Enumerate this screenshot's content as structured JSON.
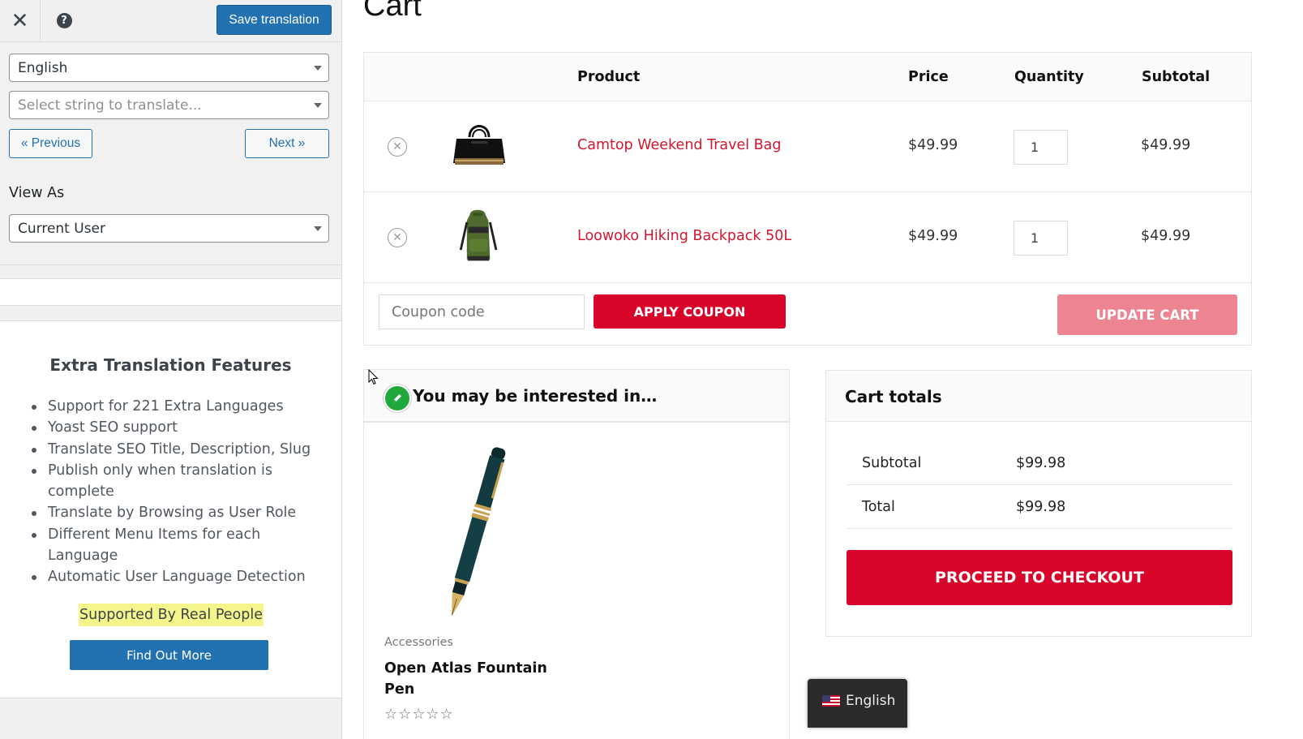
{
  "panel": {
    "close_glyph": "✕",
    "help_glyph": "?",
    "save_label": "Save translation",
    "language_value": "English",
    "string_placeholder": "Select string to translate...",
    "previous_label": "« Previous",
    "next_label": "Next »",
    "view_as_label": "View As",
    "view_as_value": "Current User",
    "promo": {
      "title": "Extra Translation Features",
      "features": [
        "Support for 221 Extra Languages",
        "Yoast SEO support",
        "Translate SEO Title, Description, Slug",
        "Publish only when translation is complete",
        "Translate by Browsing as User Role",
        "Different Menu Items for each Language",
        "Automatic User Language Detection"
      ],
      "highlight": "Supported By Real People",
      "button_label": "Find Out More"
    }
  },
  "page": {
    "title": "Cart"
  },
  "cart": {
    "headers": {
      "product": "Product",
      "price": "Price",
      "quantity": "Quantity",
      "subtotal": "Subtotal"
    },
    "remove_glyph": "✕",
    "items": [
      {
        "name": "Camtop Weekend Travel Bag",
        "price": "$49.99",
        "quantity": "1",
        "subtotal": "$49.99",
        "image_icon": "travel-bag-image"
      },
      {
        "name": "Loowoko Hiking Backpack 50L",
        "price": "$49.99",
        "quantity": "1",
        "subtotal": "$49.99",
        "image_icon": "backpack-image"
      }
    ],
    "coupon_placeholder": "Coupon code",
    "apply_label": "APPLY COUPON",
    "update_label": "UPDATE CART"
  },
  "interested": {
    "title": "You may be interested in…",
    "product": {
      "category": "Accessories",
      "name": "Open Atlas Fountain Pen",
      "stars": "☆☆☆☆☆",
      "rating": 0
    }
  },
  "totals": {
    "title": "Cart totals",
    "subtotal_label": "Subtotal",
    "subtotal_value": "$99.98",
    "total_label": "Total",
    "total_value": "$99.98",
    "checkout_label": "PROCEED TO CHECKOUT"
  },
  "language_switcher": {
    "label": "English",
    "flag_icon": "us-flag-icon"
  },
  "colors": {
    "accent_red": "#d90429",
    "link_red": "#d3172e",
    "wp_blue": "#2271b1",
    "update_pink": "#ec8591",
    "highlight_yellow": "#f4f68b"
  }
}
